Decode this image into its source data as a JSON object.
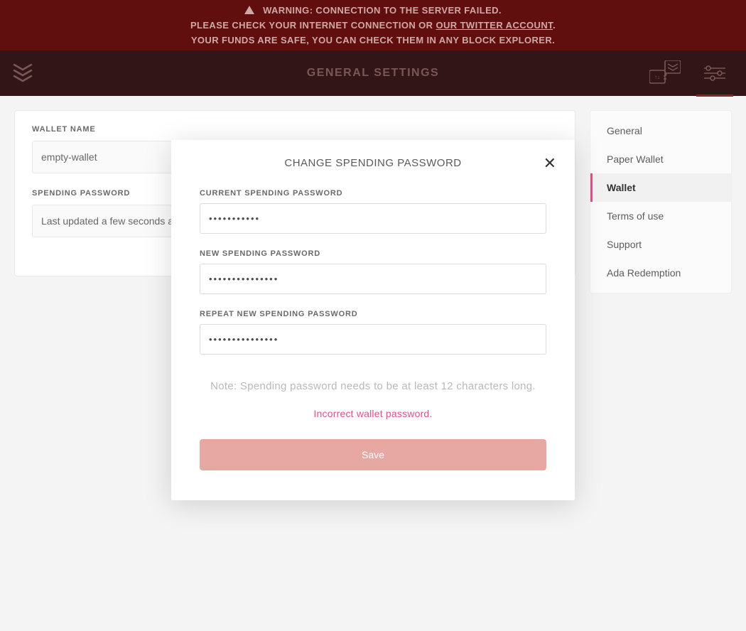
{
  "warning": {
    "line1": "WARNING: CONNECTION TO THE SERVER FAILED.",
    "line2_prefix": "PLEASE CHECK YOUR INTERNET CONNECTION OR ",
    "line2_link": "OUR TWITTER ACCOUNT",
    "line2_suffix": ".",
    "line3": "YOUR FUNDS ARE SAFE, YOU CAN CHECK THEM IN ANY BLOCK EXPLORER."
  },
  "topbar": {
    "title": "GENERAL SETTINGS"
  },
  "main": {
    "wallet_name_label": "WALLET NAME",
    "wallet_name_value": "empty-wallet",
    "spending_password_label": "SPENDING PASSWORD",
    "spending_password_status": "Last updated a few seconds a"
  },
  "sidenav": {
    "items": [
      {
        "label": "General"
      },
      {
        "label": "Paper Wallet"
      },
      {
        "label": "Wallet"
      },
      {
        "label": "Terms of use"
      },
      {
        "label": "Support"
      },
      {
        "label": "Ada Redemption"
      }
    ],
    "active_index": 2
  },
  "modal": {
    "title": "CHANGE SPENDING PASSWORD",
    "current_label": "CURRENT SPENDING PASSWORD",
    "current_value": "•••••••••••",
    "new_label": "NEW SPENDING PASSWORD",
    "new_value": "•••••••••••••••",
    "repeat_label": "REPEAT NEW SPENDING PASSWORD",
    "repeat_value": "•••••••••••••••",
    "note": "Note: Spending password needs to be at least 12 characters long.",
    "error": "Incorrect wallet password.",
    "save_label": "Save"
  },
  "colors": {
    "banner_bg": "#610e0e",
    "topbar_bg": "#321617",
    "accent": "#ea4c89",
    "save_button": "#e7a8a3",
    "error_text": "#ea4c89"
  }
}
